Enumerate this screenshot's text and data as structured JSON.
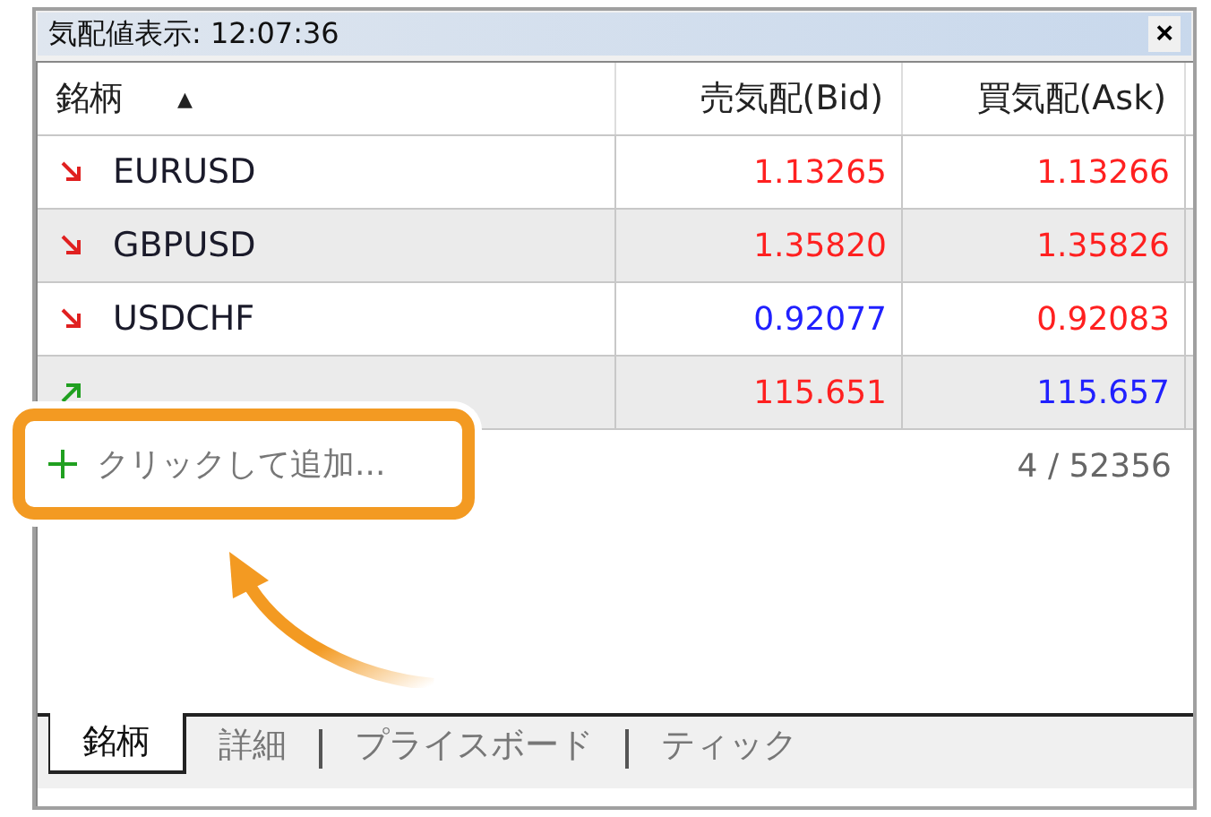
{
  "window": {
    "title": "気配値表示: 12:07:36",
    "close": "×"
  },
  "table": {
    "columns": [
      {
        "label": "銘柄",
        "sort": "▲"
      },
      {
        "label": "売気配(Bid)"
      },
      {
        "label": "買気配(Ask)"
      }
    ],
    "rows": [
      {
        "kind": "down",
        "symbol": "EURUSD",
        "bid": {
          "value": "1.13265",
          "color": "#ff2020"
        },
        "ask": {
          "value": "1.13266",
          "color": "#ff2020"
        }
      },
      {
        "kind": "down",
        "symbol": "GBPUSD",
        "bid": {
          "value": "1.35820",
          "color": "#ff2020"
        },
        "ask": {
          "value": "1.35826",
          "color": "#ff2020"
        }
      },
      {
        "kind": "down",
        "symbol": "USDCHF",
        "bid": {
          "value": "0.92077",
          "color": "#2020ff"
        },
        "ask": {
          "value": "0.92083",
          "color": "#ff2020"
        }
      },
      {
        "kind": "up",
        "bid": {
          "value": "115.651",
          "color": "#ff2020"
        },
        "ask": {
          "value": "115.657",
          "color": "#2020ff"
        }
      }
    ],
    "add_label": "クリックして追加...",
    "count": "4 / 52356"
  },
  "tabs": [
    {
      "label": "銘柄",
      "selected": true
    },
    {
      "label": "詳細",
      "selected": false
    },
    {
      "label": "プライスボード",
      "selected": false
    },
    {
      "label": "ティック",
      "selected": false
    }
  ]
}
